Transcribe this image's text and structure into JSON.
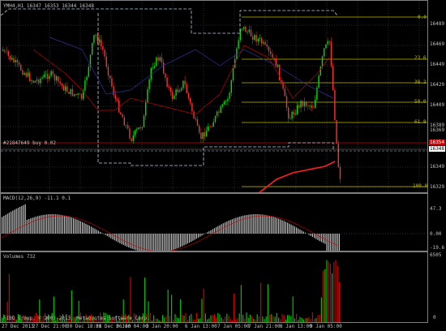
{
  "main": {
    "title": "YMH4,H1  16347 16353 16344 16348",
    "order_line": "#21847649 buy 0.02",
    "price_scale": [
      "16489",
      "16469",
      "16449",
      "16429",
      "16409",
      "16389",
      "16369",
      "16349",
      "16329",
      "16309"
    ],
    "fib_levels": [
      "0.0",
      "23.6",
      "38.2",
      "50.0",
      "61.8",
      "100.0"
    ],
    "price_tags": {
      "order": "16354",
      "current": "16348"
    },
    "colors": {
      "up_candle": "#00e000",
      "down_candle": "#ff3030",
      "fib": "#bcbc00",
      "channel": "#b8cbe0",
      "ma_red": "#c00000",
      "ma_blue": "#3030a0",
      "order_line": "#d00000"
    }
  },
  "macd": {
    "title": "MACD(12,26,9) -11.1 0.1",
    "scale": [
      "47.3",
      "0.00",
      "-19.6"
    ],
    "colors": {
      "hist": "#c0c0c0",
      "signal": "#d00000"
    }
  },
  "volumes": {
    "title": "Volumes 732",
    "scale": [
      "6505",
      "0"
    ],
    "colors": {
      "up": "#00c000",
      "down": "#d00000"
    }
  },
  "footer": {
    "copyright": "FIBO Group, © 2003-2013, MetaQuotes Software Corp."
  },
  "time_axis": [
    "27 Dec 2013",
    "27 Dec 21:00",
    "30 Dec 18:00",
    "31 Dec 06:00",
    "3 Jan 04:00",
    "3 Jan 20:00",
    "6 Jan 13:00",
    "7 Jan 05:00",
    "7 Jan 21:00",
    "8 Jan 13:00",
    "9 Jan 05:00"
  ]
}
